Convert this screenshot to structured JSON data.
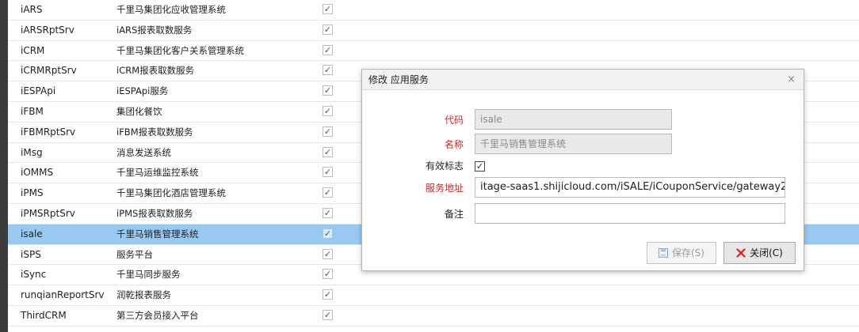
{
  "rows": [
    {
      "code": "iARS",
      "name": "千里马集团化应收管理系统",
      "checked": "✓"
    },
    {
      "code": "iARSRptSrv",
      "name": "iARS报表取数服务",
      "checked": "✓"
    },
    {
      "code": "iCRM",
      "name": "千里马集团化客户关系管理系统",
      "checked": "✓"
    },
    {
      "code": "iCRMRptSrv",
      "name": "iCRM报表取数服务",
      "checked": "✓"
    },
    {
      "code": "iESPApi",
      "name": "iESPApi服务",
      "checked": "✓"
    },
    {
      "code": "iFBM",
      "name": "集团化餐饮",
      "checked": "✓"
    },
    {
      "code": "iFBMRptSrv",
      "name": "iFBM报表取数服务",
      "checked": "✓"
    },
    {
      "code": "iMsg",
      "name": "消息发送系统",
      "checked": "✓"
    },
    {
      "code": "iOMMS",
      "name": "千里马运维监控系统",
      "checked": "✓"
    },
    {
      "code": "iPMS",
      "name": "千里马集团化酒店管理系统",
      "checked": "✓"
    },
    {
      "code": "iPMSRptSrv",
      "name": "iPMS报表取数服务",
      "checked": "✓"
    },
    {
      "code": "isale",
      "name": "千里马销售管理系统",
      "checked": "✓",
      "selected": true
    },
    {
      "code": "iSPS",
      "name": "服务平台",
      "checked": "✓"
    },
    {
      "code": "iSync",
      "name": "千里马同步服务",
      "checked": "✓"
    },
    {
      "code": "runqianReportSrv",
      "name": "润乾报表服务",
      "checked": "✓"
    },
    {
      "code": "ThirdCRM",
      "name": "第三方会员接入平台",
      "checked": "✓"
    }
  ],
  "dialog": {
    "title": "修改 应用服务",
    "close_glyph": "×",
    "code_label": "代码",
    "code_value": "isale",
    "name_label": "名称",
    "name_value": "千里马销售管理系统",
    "valid_label": "有效标志",
    "valid_checked": "✓",
    "url_label": "服务地址",
    "url_value": "itage-saas1.shijicloud.com/iSALE/iCouponService/gateway2",
    "remark_label": "备注",
    "remark_value": "",
    "save_label": "保存(S)",
    "close_label": "关闭(C)"
  },
  "colors": {
    "selected_row": "#99c9f3",
    "required_label": "#e02020",
    "close_x": "#e02020"
  }
}
